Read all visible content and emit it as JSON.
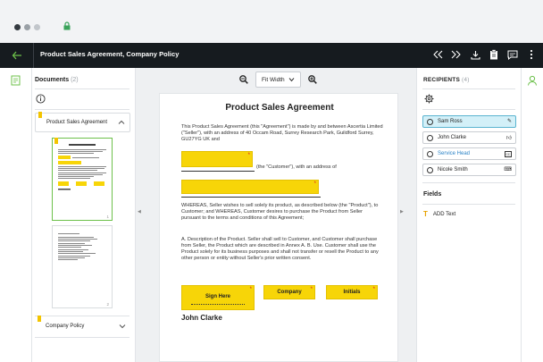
{
  "app": {
    "title": "Product Sales Agreement, Company Policy"
  },
  "colors": {
    "accent_green": "#6cc04a",
    "field_yellow": "#f7d508",
    "header_dark": "#161b1f",
    "link_blue": "#2b83c7",
    "active_row": "#d3f0f8"
  },
  "header_icons": [
    "back-arrow-icon",
    "double-chevron-left-icon",
    "double-chevron-right-icon",
    "download-icon",
    "clipboard-icon",
    "comment-icon",
    "more-vertical-icon"
  ],
  "documents": {
    "label": "Documents",
    "count": "(2)",
    "items": [
      {
        "label": "Product Sales Agreement",
        "expanded": true,
        "page_numbers": [
          "1",
          "2"
        ]
      },
      {
        "label": "Company Policy",
        "expanded": false
      }
    ]
  },
  "viewer": {
    "zoom_mode": "Fit Width"
  },
  "document": {
    "title": "Product Sales Agreement",
    "intro": "This Product Sales Agreement (this \"Agreement\") is made by and between Ascertia Limited (\"Seller\"), with an address of 40 Occam Road, Surrey Research Park, Guildford Surrey, GU27YG UK and",
    "customer_line": "(the \"Customer\"), with an address of",
    "whereas": "WHEREAS, Seller wishes to sell solely its product, as described below (the \"Product\"), to Customer; and WHEREAS, Customer desires to purchase the Product from Seller pursuant to the terms and conditions of this Agreement;",
    "clauses": "A. Description of the Product. Seller shall sell to Customer, and Customer shall purchase from Seller, the Product which are described in Annex A. B. Use. Customer shall use the Product solely for its business purposes and shall not transfer or resell the Product to any other person or entity without Seller's prior written consent.",
    "fields": {
      "sign_here": "Sign Here",
      "company": "Company",
      "initials": "Initials"
    },
    "signer_name": "John Clarke"
  },
  "recipients": {
    "label": "RECIPIENTS",
    "count": "(4)",
    "items": [
      {
        "name": "Sam Ross",
        "icon": "pen-icon",
        "active": true
      },
      {
        "name": "John Clarke",
        "icon": "thumbs-up-icon"
      },
      {
        "name": "Service Head",
        "icon": "cc-icon",
        "link": true
      },
      {
        "name": "Nicole Smith",
        "icon": "edit-cursor-icon"
      }
    ]
  },
  "fields_panel": {
    "label": "Fields",
    "items": [
      {
        "label": "ADD Text",
        "icon": "text-tool-icon"
      }
    ]
  }
}
